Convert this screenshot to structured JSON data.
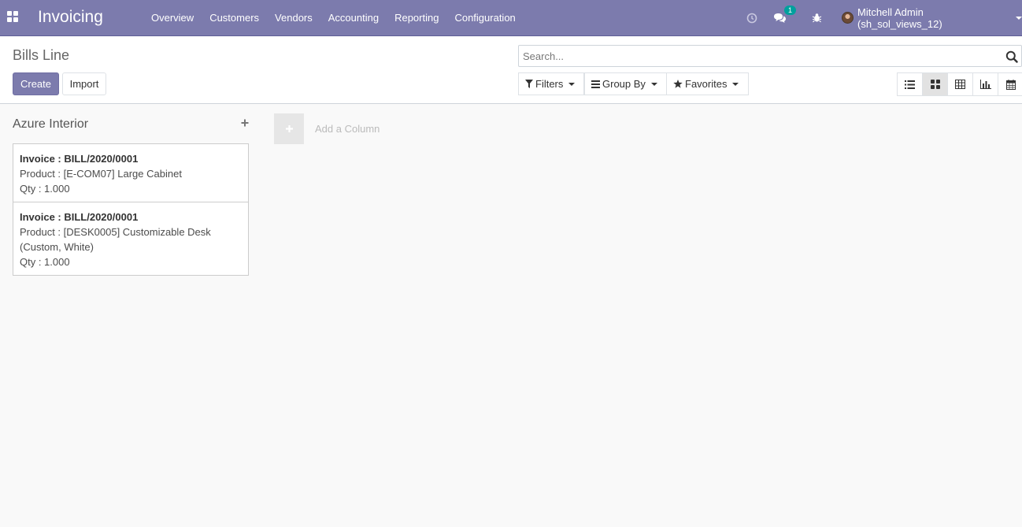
{
  "navbar": {
    "brand": "Invoicing",
    "menu": [
      "Overview",
      "Customers",
      "Vendors",
      "Accounting",
      "Reporting",
      "Configuration"
    ],
    "icons": {
      "apps": "apps-grid-icon",
      "activity": "clock-icon",
      "messages": "chat-icon",
      "debug": "bug-icon"
    },
    "messages_badge": "1",
    "user": "Mitchell Admin (sh_sol_views_12)"
  },
  "control_panel": {
    "title": "Bills Line",
    "create_label": "Create",
    "import_label": "Import",
    "search_placeholder": "Search...",
    "filters_label": "Filters",
    "group_by_label": "Group By",
    "favorites_label": "Favorites",
    "views": [
      "list",
      "kanban",
      "pivot",
      "graph",
      "calendar"
    ],
    "active_view": "kanban"
  },
  "kanban": {
    "column": {
      "title": "Azure Interior",
      "cards": [
        {
          "invoice": "Invoice : BILL/2020/0001",
          "product": "Product : [E-COM07] Large Cabinet",
          "qty": "Qty : 1.000"
        },
        {
          "invoice": "Invoice : BILL/2020/0001",
          "product": "Product : [DESK0005] Customizable Desk (Custom, White)",
          "qty": "Qty : 1.000"
        }
      ]
    },
    "add_column_label": "Add a Column"
  },
  "colors": {
    "navbar": "#7c7bad",
    "primary": "#7c7bad",
    "badge": "#00a09d"
  }
}
